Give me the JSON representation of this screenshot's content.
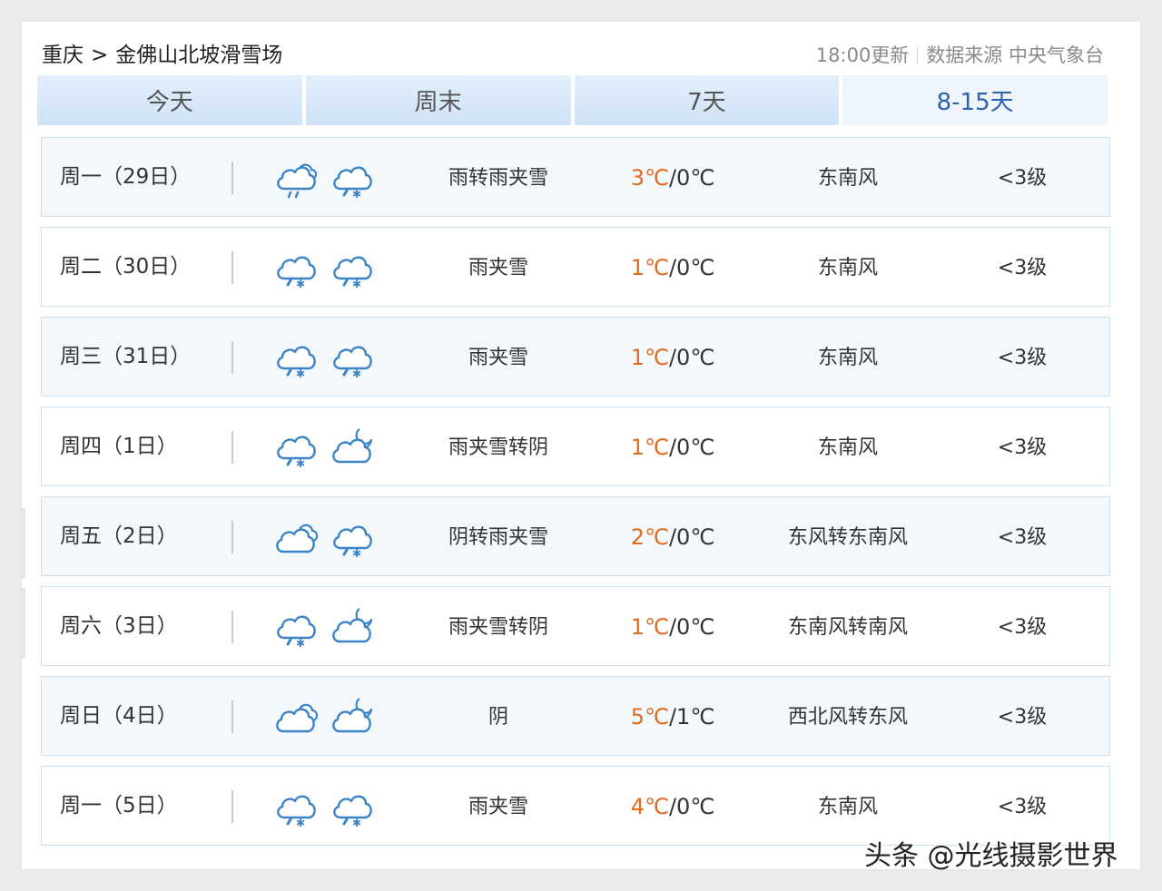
{
  "header": {
    "breadcrumb_city": "重庆",
    "breadcrumb_sep": ">",
    "breadcrumb_place": "金佛山北坡滑雪场",
    "update_time": "18:00更新",
    "source_label": "数据来源 中央气象台"
  },
  "tabs": [
    {
      "label": "今天",
      "active": false
    },
    {
      "label": "周末",
      "active": false
    },
    {
      "label": "7天",
      "active": false
    },
    {
      "label": "8-15天",
      "active": true
    }
  ],
  "forecast": [
    {
      "day": "周一（29日）",
      "icon_day": "rain-icon",
      "icon_night": "sleet-icon",
      "condition": "雨转雨夹雪",
      "high": "3℃",
      "sep": "/",
      "low": "0℃",
      "wind": "东南风",
      "level": "<3级"
    },
    {
      "day": "周二（30日）",
      "icon_day": "sleet-icon",
      "icon_night": "sleet-icon",
      "condition": "雨夹雪",
      "high": "1℃",
      "sep": "/",
      "low": "0℃",
      "wind": "东南风",
      "level": "<3级"
    },
    {
      "day": "周三（31日）",
      "icon_day": "sleet-icon",
      "icon_night": "sleet-icon",
      "condition": "雨夹雪",
      "high": "1℃",
      "sep": "/",
      "low": "0℃",
      "wind": "东南风",
      "level": "<3级"
    },
    {
      "day": "周四（1日）",
      "icon_day": "sleet-icon",
      "icon_night": "overcast-night-icon",
      "condition": "雨夹雪转阴",
      "high": "1℃",
      "sep": "/",
      "low": "0℃",
      "wind": "东南风",
      "level": "<3级"
    },
    {
      "day": "周五（2日）",
      "icon_day": "overcast-icon",
      "icon_night": "sleet-icon",
      "condition": "阴转雨夹雪",
      "high": "2℃",
      "sep": "/",
      "low": "0℃",
      "wind": "东风转东南风",
      "level": "<3级"
    },
    {
      "day": "周六（3日）",
      "icon_day": "sleet-icon",
      "icon_night": "overcast-night-icon",
      "condition": "雨夹雪转阴",
      "high": "1℃",
      "sep": "/",
      "low": "0℃",
      "wind": "东南风转南风",
      "level": "<3级"
    },
    {
      "day": "周日（4日）",
      "icon_day": "overcast-icon",
      "icon_night": "overcast-night-icon",
      "condition": "阴",
      "high": "5℃",
      "sep": "/",
      "low": "1℃",
      "wind": "西北风转东风",
      "level": "<3级"
    },
    {
      "day": "周一（5日）",
      "icon_day": "sleet-icon",
      "icon_night": "sleet-icon",
      "condition": "雨夹雪",
      "high": "4℃",
      "sep": "/",
      "low": "0℃",
      "wind": "东南风",
      "level": "<3级"
    }
  ],
  "colors": {
    "accent": "#2d63ad",
    "high_temp": "#e36a1d",
    "icon_stroke": "#3d84c6"
  },
  "watermark": "头条 @光线摄影世界"
}
